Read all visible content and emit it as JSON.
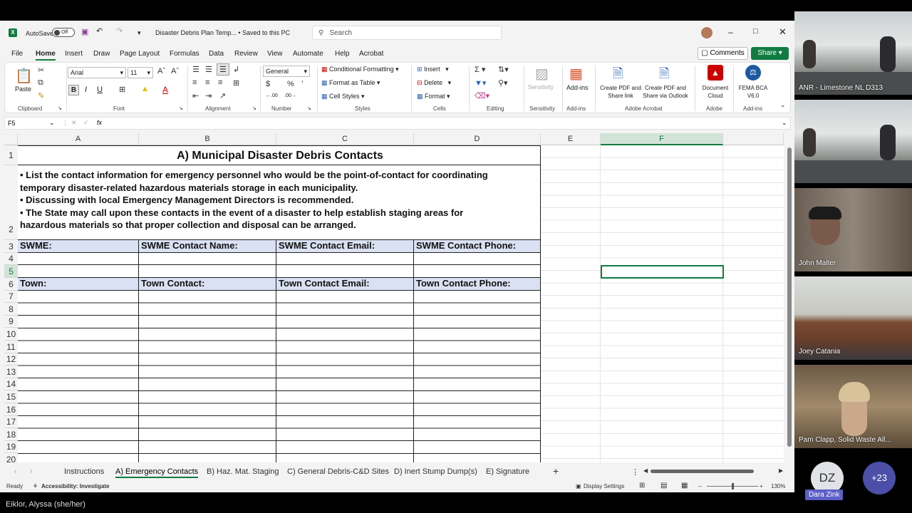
{
  "titlebar": {
    "autosave_label": "AutoSave",
    "autosave_state": "Off",
    "doc_title": "Disaster Debris Plan Temp... • Saved to this PC",
    "search_placeholder": "Search"
  },
  "menu": [
    "File",
    "Home",
    "Insert",
    "Draw",
    "Page Layout",
    "Formulas",
    "Data",
    "Review",
    "View",
    "Automate",
    "Help",
    "Acrobat"
  ],
  "comments_label": "Comments",
  "share_label": "Share",
  "ribbon": {
    "clipboard": {
      "paste": "Paste",
      "group": "Clipboard"
    },
    "font": {
      "name": "Arial",
      "size": "11",
      "group": "Font"
    },
    "alignment_group": "Alignment",
    "number": {
      "format": "General",
      "group": "Number"
    },
    "styles": {
      "cond": "Conditional Formatting",
      "table": "Format as Table",
      "cell": "Cell Styles",
      "group": "Styles"
    },
    "cells": {
      "insert": "Insert",
      "delete": "Delete",
      "format": "Format",
      "group": "Cells"
    },
    "editing_group": "Editing",
    "sensitivity": {
      "label": "Sensitivity",
      "group": "Sensitivity"
    },
    "addins": {
      "label": "Add-ins",
      "group": "Add-ins"
    },
    "acrobat": {
      "pdf_share": "Create PDF and Share link",
      "pdf_outlook": "Create PDF and Share via Outlook",
      "group": "Adobe Acrobat"
    },
    "adobe": {
      "label": "Document Cloud",
      "group": "Adobe"
    },
    "fema": {
      "label": "FEMA BCA V6.0",
      "group": "Add-ins"
    }
  },
  "formula_bar": {
    "cell_ref": "F5",
    "fx": "fx",
    "value": ""
  },
  "columns": [
    "A",
    "B",
    "C",
    "D",
    "E",
    "F"
  ],
  "rows": [
    "1",
    "2",
    "3",
    "4",
    "5",
    "6",
    "7",
    "8",
    "9",
    "10",
    "11",
    "12",
    "13",
    "14",
    "15",
    "16",
    "17",
    "18",
    "19",
    "20"
  ],
  "sheet": {
    "title": "A) Municipal Disaster Debris Contacts",
    "instructions": [
      "• List the contact information for emergency personnel who would be the point-of-contact for coordinating",
      "temporary disaster-related hazardous materials storage in each municipality.",
      "• Discussing with local Emergency Management Directors is recommended.",
      "• The State may call upon these contacts in the event of a disaster to help establish staging areas for",
      "hazardous materials so that proper collection and disposal can be arranged."
    ],
    "swme_headers": [
      "SWME:",
      "SWME Contact Name:",
      "SWME Contact Email:",
      "SWME Contact Phone:"
    ],
    "town_headers": [
      "Town:",
      "Town Contact:",
      "Town Contact Email:",
      "Town Contact Phone:"
    ]
  },
  "tabs": [
    "Instructions",
    "A) Emergency Contacts",
    "B) Haz. Mat. Staging",
    "C) General Debris-C&D Sites",
    "D) Inert Stump Dump(s)",
    "E) Signature"
  ],
  "status": {
    "ready": "Ready",
    "accessibility": "Accessibility: Investigate",
    "display": "Display Settings",
    "zoom": "130%"
  },
  "participants": [
    {
      "name": "ANR - Limestone NL D313"
    },
    {
      "name": ""
    },
    {
      "name": "John Malter"
    },
    {
      "name": "Joey Catania"
    },
    {
      "name": "Pam Clapp, Solid Waste All..."
    }
  ],
  "dara": {
    "initials": "DZ",
    "name": "Dara Zink"
  },
  "more_count": "+23",
  "presenter": "Eiklor, Alyssa (she/her)"
}
